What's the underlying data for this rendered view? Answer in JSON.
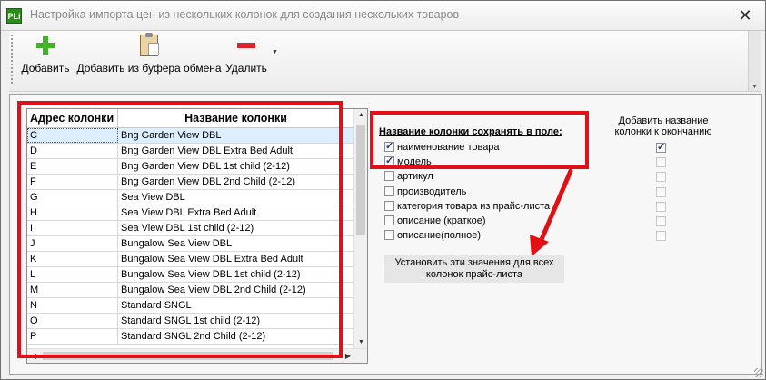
{
  "window": {
    "app_icon": "PLi",
    "title": "Настройка импорта цен из нескольких колонок для создания нескольких товаров",
    "close_glyph": "✕"
  },
  "toolbar": {
    "add_label": "Добавить",
    "add_clipboard_label": "Добавить из буфера обмена",
    "delete_label": "Удалить",
    "icons": [
      "plus-icon",
      "clipboard-icon",
      "minus-icon"
    ]
  },
  "grid": {
    "headers": {
      "address": "Адрес колонки",
      "name": "Название колонки"
    },
    "selected_row": 0,
    "rows": [
      {
        "address": "C",
        "name": "Bng Garden View DBL"
      },
      {
        "address": "D",
        "name": "Bng Garden View DBL Extra Bed Adult"
      },
      {
        "address": "E",
        "name": "Bng Garden View DBL 1st child (2-12)"
      },
      {
        "address": "F",
        "name": "Bng Garden View DBL 2nd Child (2-12)"
      },
      {
        "address": "G",
        "name": "Sea View DBL"
      },
      {
        "address": "H",
        "name": "Sea View DBL Extra Bed Adult"
      },
      {
        "address": "I",
        "name": "Sea View DBL 1st child (2-12)"
      },
      {
        "address": "J",
        "name": "Bungalow Sea View DBL"
      },
      {
        "address": "K",
        "name": "Bungalow Sea View DBL Extra Bed Adult"
      },
      {
        "address": "L",
        "name": "Bungalow Sea View DBL 1st child (2-12)"
      },
      {
        "address": "M",
        "name": "Bungalow Sea View DBL 2nd Child (2-12)"
      },
      {
        "address": "N",
        "name": "Standard SNGL"
      },
      {
        "address": "O",
        "name": "Standard SNGL 1st child (2-12)"
      },
      {
        "address": "P",
        "name": "Standard SNGL 2nd Child (2-12)"
      }
    ]
  },
  "fields_panel": {
    "title": "Название колонки сохранять в поле:",
    "append_title": "Добавить название колонки к окончанию",
    "fields": [
      {
        "label": "наименование товара",
        "checked": true,
        "append": true
      },
      {
        "label": "модель",
        "checked": true,
        "append": false
      },
      {
        "label": "артикул",
        "checked": false,
        "append": false
      },
      {
        "label": "производитель",
        "checked": false,
        "append": false
      },
      {
        "label": "категория товара из прайс-листа",
        "checked": false,
        "append": false
      },
      {
        "label": "описание (краткое)",
        "checked": false,
        "append": false
      },
      {
        "label": "описание(полное)",
        "checked": false,
        "append": false
      }
    ],
    "apply_button": "Установить эти значения для всех колонок прайс-листа"
  },
  "colors": {
    "highlight_red": "#e01016",
    "selection": "#ddeeff",
    "add_green": "#43b02a",
    "delete_red": "#e0202a"
  }
}
